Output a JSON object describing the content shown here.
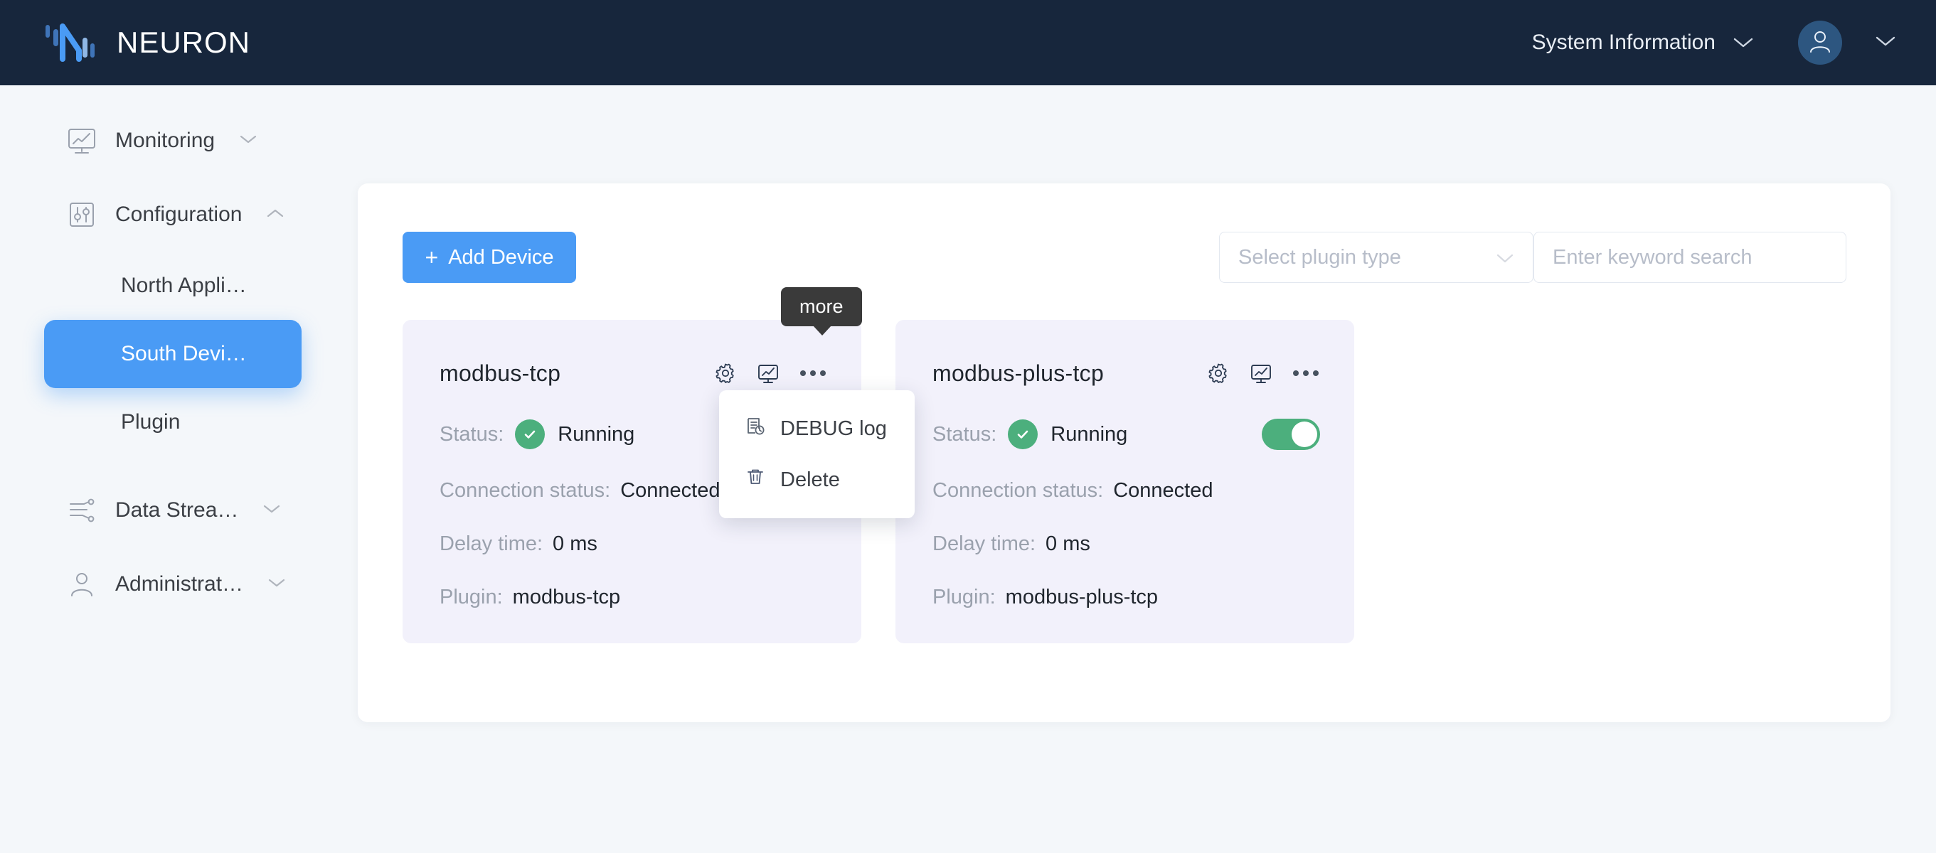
{
  "header": {
    "brand": "NEURON",
    "logo_icon": "neuron-logo-icon",
    "system_info_label": "System Information",
    "system_info_caret": "chevron-down-icon",
    "avatar_icon": "user-avatar-icon",
    "user_caret": "chevron-down-icon",
    "bg_color": "#17263c"
  },
  "sidebar": {
    "items": [
      {
        "label": "Monitoring",
        "icon": "monitor-chart-icon",
        "caret": "chevron-down-icon",
        "type": "group",
        "expanded": false
      },
      {
        "label": "Configuration",
        "icon": "sliders-icon",
        "caret": "chevron-up-icon",
        "type": "group",
        "expanded": true
      },
      {
        "label": "North Appli…",
        "type": "sub",
        "active": false
      },
      {
        "label": "South Devi…",
        "type": "sub",
        "active": true
      },
      {
        "label": "Plugin",
        "type": "sub",
        "active": false
      },
      {
        "label": "Data Strea…",
        "icon": "data-stream-icon",
        "caret": "chevron-down-icon",
        "type": "group",
        "expanded": false
      },
      {
        "label": "Administrat…",
        "icon": "user-admin-icon",
        "caret": "chevron-down-icon",
        "type": "group",
        "expanded": false
      }
    ],
    "active_color": "#4a9bf5"
  },
  "toolbar": {
    "add_device_label": "Add Device",
    "add_device_plus": "+",
    "plugin_select_placeholder": "Select plugin type",
    "plugin_select_caret": "chevron-down-icon",
    "search_placeholder": "Enter keyword search"
  },
  "tooltip": {
    "text": "more"
  },
  "context_menu": {
    "items": [
      {
        "label": "DEBUG log",
        "icon": "debug-log-icon"
      },
      {
        "label": "Delete",
        "icon": "trash-icon"
      }
    ]
  },
  "labels": {
    "status": "Status:",
    "connection_status": "Connection status:",
    "delay_time": "Delay time:",
    "plugin": "Plugin:"
  },
  "cards": [
    {
      "title": "modbus-tcp",
      "status": "Running",
      "status_icon": "check-circle-icon",
      "connection_status": "Connected",
      "delay_time": "0 ms",
      "plugin": "modbus-tcp",
      "toggle_visible": false,
      "actions": [
        "gear-icon",
        "monitor-chart-icon",
        "more-dots-icon"
      ]
    },
    {
      "title": "modbus-plus-tcp",
      "status": "Running",
      "status_icon": "check-circle-icon",
      "connection_status": "Connected",
      "delay_time": "0 ms",
      "plugin": "modbus-plus-tcp",
      "toggle_visible": true,
      "toggle_on": true,
      "actions": [
        "gear-icon",
        "monitor-chart-icon",
        "more-dots-icon"
      ]
    }
  ],
  "colors": {
    "accent": "#4a9bf5",
    "header_bg": "#17263c",
    "page_bg": "#f4f7fa",
    "card_bg": "#f2f1fb",
    "success": "#4caf7d",
    "tooltip_bg": "#3a3a3a"
  }
}
